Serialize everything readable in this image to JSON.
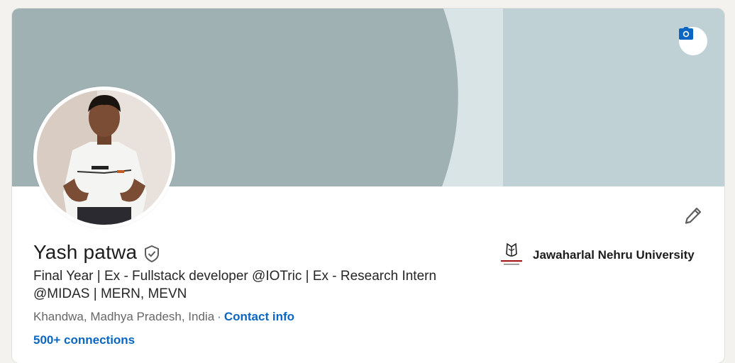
{
  "profile": {
    "name": "Yash patwa",
    "headline": "Final Year | Ex - Fullstack developer @IOTric | Ex - Research Intern @MIDAS | MERN, MEVN",
    "location": "Khandwa, Madhya Pradesh, India",
    "separator": "·",
    "contact_label": "Contact info",
    "connections": "500+ connections"
  },
  "education": {
    "school": "Jawaharlal Nehru University"
  },
  "icons": {
    "banner_edit": "camera-icon",
    "profile_edit": "pencil-icon",
    "verified": "shield-check-icon",
    "school_logo": "jnu-logo"
  },
  "colors": {
    "link": "#0a66c2",
    "banner_dark": "#a0b1b4",
    "banner_light": "#d9e4e6",
    "banner_right": "#bfd1d5"
  }
}
